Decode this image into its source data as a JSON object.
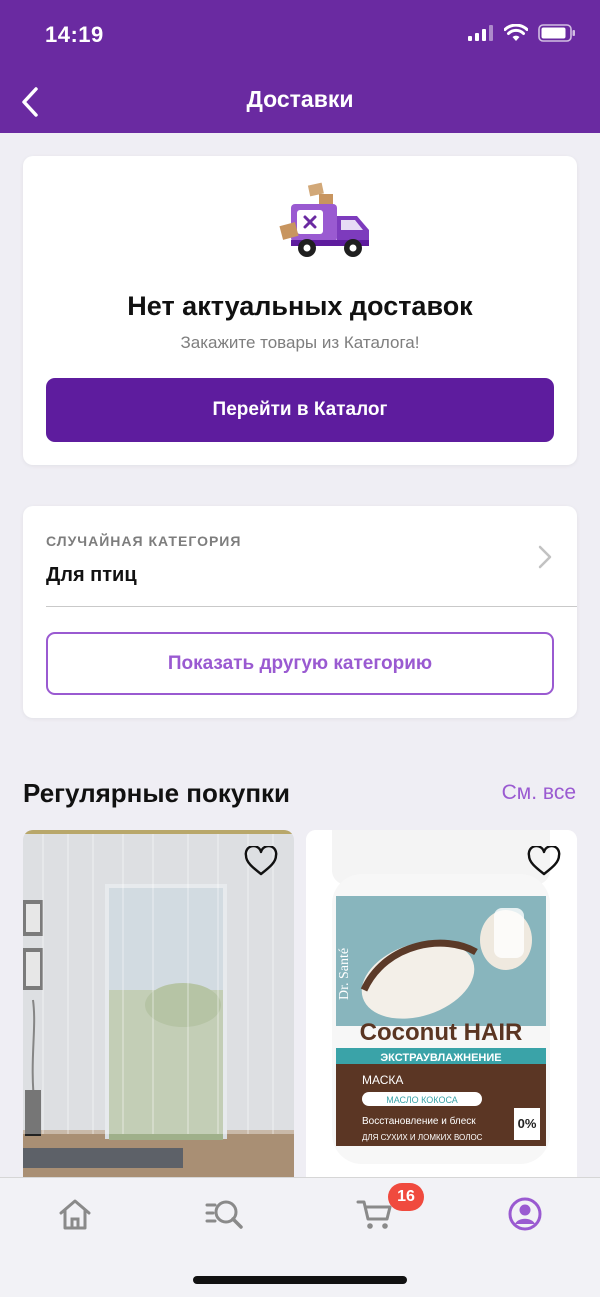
{
  "status": {
    "time": "14:19"
  },
  "nav": {
    "title": "Доставки"
  },
  "deliveries": {
    "empty_title": "Нет актуальных доставок",
    "empty_subtitle": "Закажите товары из Каталога!",
    "catalog_button": "Перейти в Каталог"
  },
  "random_category": {
    "label": "СЛУЧАЙНАЯ КАТЕГОРИЯ",
    "value": "Для птиц",
    "show_other_button": "Показать другую категорию"
  },
  "regular_purchases": {
    "title": "Регулярные покупки",
    "see_all": "См. все",
    "products": [
      {
        "image": "curtain-photo"
      },
      {
        "image": "hair-mask-jar-photo",
        "brand": "Dr. Santé",
        "name": "Coconut HAIR",
        "line": "ЭКСТРАУВЛАЖНЕНИЕ",
        "type": "МАСКА",
        "ingredient": "МАСЛО КОКОСА",
        "benefit": "Восстановление и блеск",
        "hair_type": "ДЛЯ СУХИХ И ЛОМКИХ ВОЛОС",
        "percent": "0%"
      }
    ]
  },
  "tabbar": {
    "cart_badge": "16",
    "tabs": [
      "home-icon",
      "search-catalog-icon",
      "cart-icon",
      "profile-icon"
    ]
  },
  "colors": {
    "brand": "#6a2aa1",
    "primary_button": "#5e1c9e",
    "accent": "#9a5ad1",
    "badge": "#f04a3e"
  }
}
